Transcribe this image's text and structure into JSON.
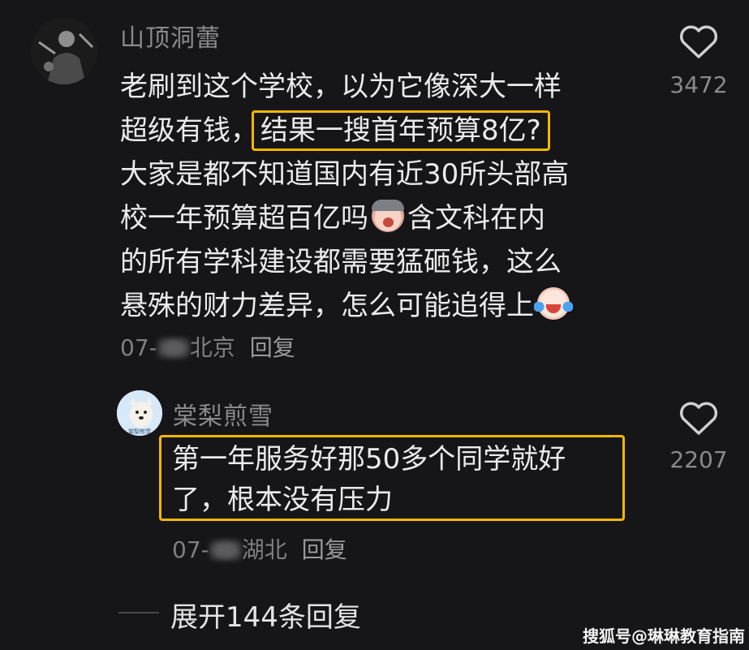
{
  "comments": [
    {
      "username": "山顶洞蕾",
      "lines": [
        {
          "text": "老刷到这个学校，以为它像深大一样"
        },
        {
          "prefix": "超级有钱，",
          "highlight": "结果一搜首年预算8亿?"
        },
        {
          "text": "大家是都不知道国内有近30所头部高"
        },
        {
          "before": "校一年预算超百亿吗",
          "emoji": "crying-emoji",
          "after": "含文科在内"
        },
        {
          "text": "的所有学科建设都需要猛砸钱，这么"
        },
        {
          "before": "悬殊的财力差异，怎么可能追得上",
          "emoji": "laugh-cry-emoji"
        }
      ],
      "meta_date_prefix": "07-",
      "meta_location": "北京",
      "reply_label": "回复",
      "like_count": "3472"
    },
    {
      "username": "棠梨煎雪",
      "avatar_caption": "棠梨煎雪",
      "lines": [
        {
          "text": "第一年服务好那50多个同学就好"
        },
        {
          "text": "了，根本没有压力"
        }
      ],
      "meta_date_prefix": "07-",
      "meta_location": "湖北",
      "reply_label": "回复",
      "like_count": "2207"
    }
  ],
  "expand_replies_label": "展开144条回复",
  "watermark": "搜狐号@琳琳教育指南",
  "colors": {
    "background": "#161619",
    "highlight_border": "#f6b700",
    "text": "#ebebeb",
    "muted": "#8a8a8e"
  }
}
